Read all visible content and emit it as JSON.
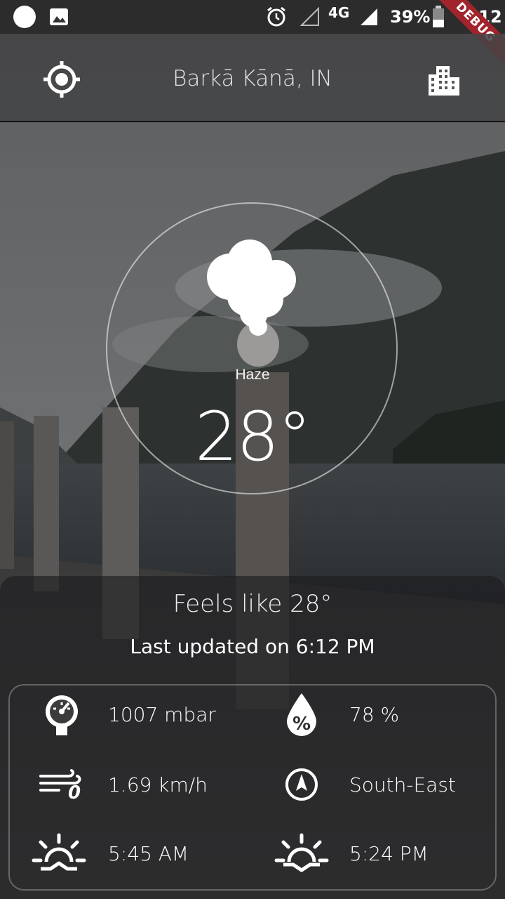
{
  "status_bar": {
    "network": "4G",
    "battery": "39%",
    "time": "6:12",
    "debug_label": "DEBUG"
  },
  "app_bar": {
    "location": "Barkā Kānā, IN",
    "left_icon": "my-location-icon",
    "right_icon": "city-icon"
  },
  "weather": {
    "icon": "haze-cloud-icon",
    "condition": "Haze",
    "temperature": "28°"
  },
  "summary": {
    "feels_like": "Feels like 28°",
    "last_updated": "Last updated on 6:12 PM"
  },
  "details": {
    "pressure": "1007 mbar",
    "humidity": "78 %",
    "wind_speed": "1.69 km/h",
    "wind_direction": "South-East",
    "sunrise": "5:45 AM",
    "sunset": "5:24 PM"
  }
}
